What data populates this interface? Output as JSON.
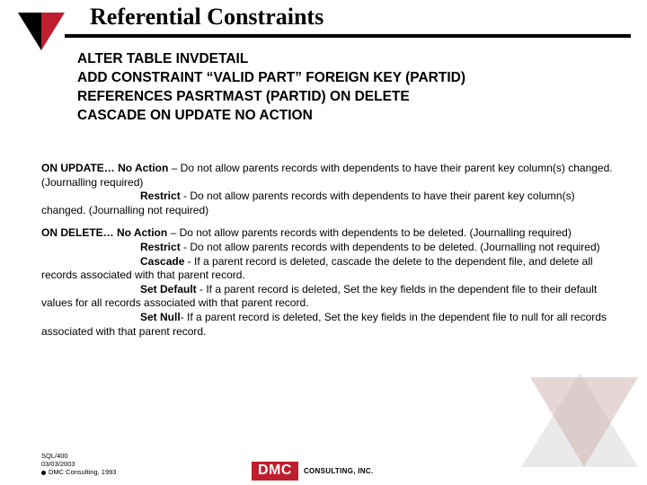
{
  "title": "Referential Constraints",
  "sql": {
    "line1": "ALTER TABLE INVDETAIL",
    "line2": "ADD CONSTRAINT “VALID PART” FOREIGN KEY (PARTID)",
    "line3": "REFERENCES PASRTMAST (PARTID) ON DELETE",
    "line4": "CASCADE ON UPDATE NO ACTION"
  },
  "onupdate": {
    "heading": "ON UPDATE… No Action",
    "noaction": " – Do not allow parents records with dependents to have their parent key column(s) changed.  (Journalling required)",
    "restrict_label": "Restrict",
    "restrict": " - Do not allow parents records with dependents to have their parent key column(s) changed.  (Journalling not required)"
  },
  "ondelete": {
    "heading": "ON DELETE… No Action",
    "noaction": " – Do not allow parents records with dependents to be deleted.  (Journalling required)",
    "restrict_label": "Restrict",
    "restrict": " - Do not allow parents records with dependents to be deleted.  (Journalling not required)",
    "cascade_label": "Cascade",
    "cascade": " - If a parent record is deleted, cascade the delete to the dependent file, and delete all records associated with that parent record.",
    "setdefault_label": "Set Default",
    "setdefault": " - If a parent record is deleted, Set the key fields in the dependent file to their default values for all records associated with that parent record.",
    "setnull_label": "Set Null",
    "setnull": "- If a parent record is deleted, Set the key fields in the dependent file to null for all records associated with that parent record."
  },
  "footer": {
    "line1": "SQL/400",
    "line2": "03/03/2003",
    "line3": "DMC Consulting, 1993"
  },
  "logo": {
    "brand": "DMC",
    "tag": "CONSULTING, INC."
  }
}
